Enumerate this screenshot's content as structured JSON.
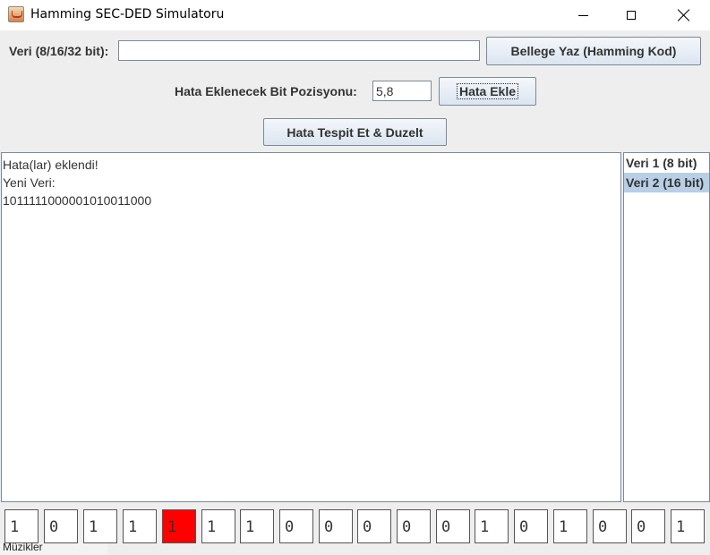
{
  "window": {
    "title": "Hamming SEC-DED Simulatoru"
  },
  "input_row": {
    "label": "Veri (8/16/32 bit):",
    "value": "",
    "write_button": "Bellege Yaz (Hamming Kod)"
  },
  "error_row": {
    "label": "Hata Eklenecek Bit Pozisyonu:",
    "value": "5,8",
    "add_button": "Hata Ekle"
  },
  "detect_button": "Hata Tespit Et & Duzelt",
  "output": {
    "lines": [
      "Hata(lar) eklendi!",
      "Yeni Veri:",
      "101111100000101001100 0"
    ]
  },
  "memory_list": {
    "items": [
      {
        "label": "Veri 1 (8 bit)",
        "selected": false
      },
      {
        "label": "Veri 2 (16 bit)",
        "selected": true
      }
    ]
  },
  "bits": [
    "1",
    "0",
    "1",
    "1",
    "1",
    "1",
    "1",
    "0",
    "0",
    "0",
    "0",
    "0",
    "1",
    "0",
    "1",
    "0",
    "0",
    "1"
  ],
  "error_bit_index": 4,
  "error_color": "#ff0000",
  "background_window_text": "Müzikler"
}
